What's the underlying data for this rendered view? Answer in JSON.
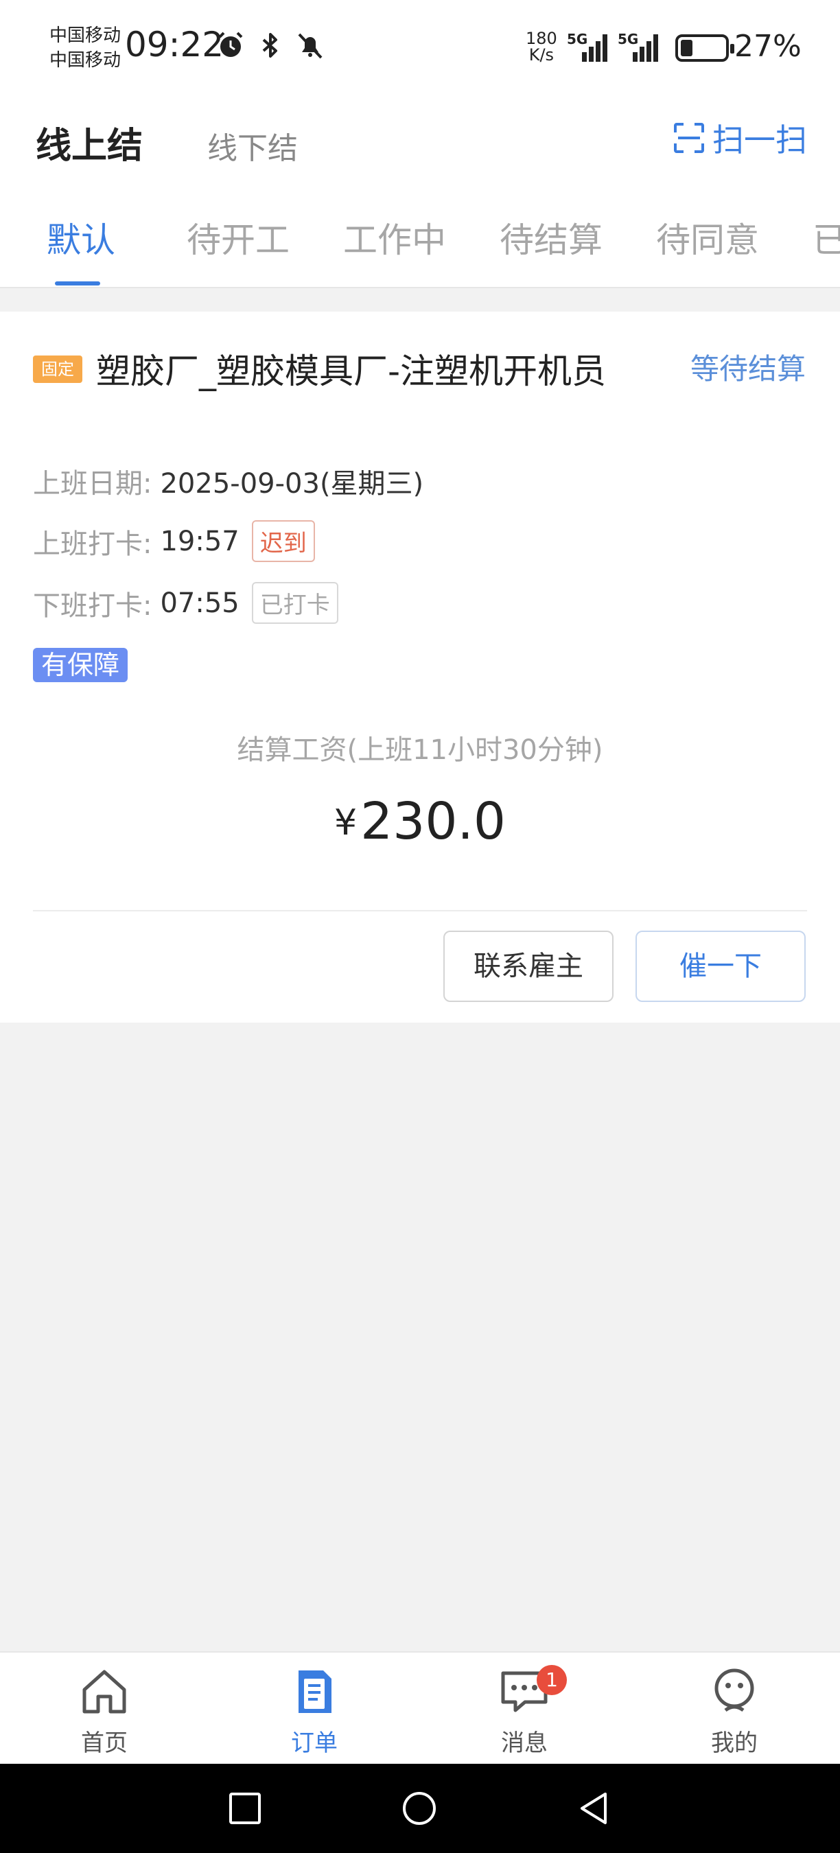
{
  "status_bar": {
    "carrier_1": "中国移动",
    "carrier_2": "中国移动",
    "time": "09:22",
    "net_speed_value": "180",
    "net_speed_unit": "K/s",
    "signal_1_label": "5G",
    "signal_2_label": "5G",
    "battery_percent": "27%",
    "battery_level": 0.27
  },
  "header": {
    "tab_online": "线上结",
    "tab_offline": "线下结",
    "scan_label": "扫一扫"
  },
  "filter_tabs": [
    "默认",
    "待开工",
    "工作中",
    "待结算",
    "待同意",
    "已"
  ],
  "order": {
    "tag": "固定",
    "title": "塑胶厂_塑胶模具厂-注塑机开机员",
    "status": "等待结算",
    "date_label": "上班日期:",
    "date_value": "2025-09-03(星期三)",
    "checkin_label": "上班打卡:",
    "checkin_time": "19:57",
    "checkin_badge": "迟到",
    "checkout_label": "下班打卡:",
    "checkout_time": "07:55",
    "checkout_badge": "已打卡",
    "guarantee_badge": "有保障",
    "salary_label": "结算工资(上班11小时30分钟)",
    "currency": "¥",
    "salary_amount": "230.0",
    "btn_contact": "联系雇主",
    "btn_urge": "催一下"
  },
  "bottom_nav": {
    "home": "首页",
    "orders": "订单",
    "messages": "消息",
    "messages_badge": "1",
    "mine": "我的"
  },
  "colors": {
    "accent": "#3a7de0",
    "tag_fixed": "#f7a94a",
    "late": "#e2664a",
    "guarantee": "#6b8ef2",
    "badge": "#e84d3c"
  }
}
